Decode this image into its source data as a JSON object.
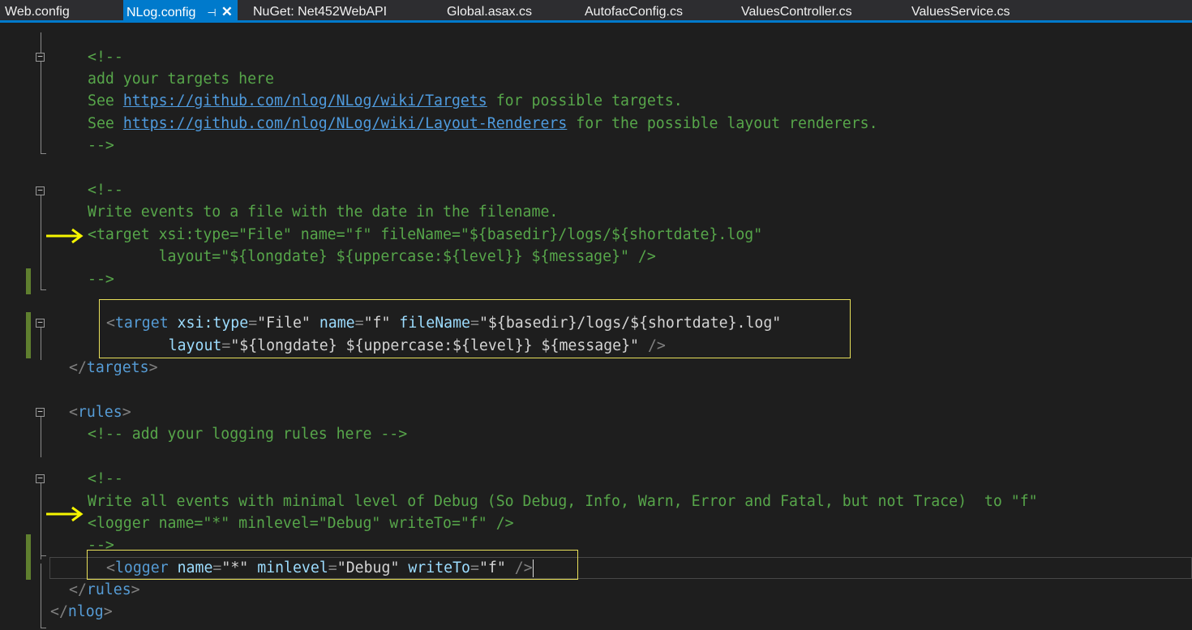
{
  "tabs": [
    {
      "label": "Web.config",
      "active": false
    },
    {
      "label": "NLog.config",
      "active": true
    },
    {
      "label": "NuGet: Net452WebAPI",
      "active": false
    },
    {
      "label": "Global.asax.cs",
      "active": false
    },
    {
      "label": "AutofacConfig.cs",
      "active": false
    },
    {
      "label": "ValuesController.cs",
      "active": false
    },
    {
      "label": "ValuesService.cs",
      "active": false
    }
  ],
  "colors": {
    "comment": "#57a64a",
    "link": "#4f9bde",
    "tag": "#569cd6",
    "attribute": "#9cdcfe",
    "string": "#d4d4d4",
    "delimiter": "#808080",
    "highlight_box": "#e8e05a",
    "arrow": "#f5f500",
    "tab_accent": "#007acc"
  },
  "icons": {
    "pin": "pin-icon",
    "close": "close-icon",
    "fold": "collapse-box-icon",
    "annotation": "arrow-right-icon"
  },
  "code": {
    "c1_open": "<!--",
    "c1_add": "add your targets here",
    "c1_see": "See ",
    "c1_link1": "https://github.com/nlog/NLog/wiki/Targets",
    "c1_for1": " for possible targets.",
    "c1_link2": "https://github.com/nlog/NLog/wiki/Layout-Renderers",
    "c1_for2": " for the possible layout renderers.",
    "c1_close": "-->",
    "c2_open": "<!--",
    "c2_text": "Write events to a file with the date in the filename.",
    "c2_target": "<target xsi:type=\"File\" name=\"f\" fileName=\"${basedir}/logs/${shortdate}.log\"",
    "c2_layout": "        layout=\"${longdate} ${uppercase:${level}} ${message}\" />",
    "c2_close": "-->",
    "tgt_lt": "<",
    "tgt_tag": "target",
    "tgt_a1": "xsi:type",
    "tgt_v1": "\"File\"",
    "tgt_a2": "name",
    "tgt_v2": "\"f\"",
    "tgt_a3": "fileName",
    "tgt_v3": "\"${basedir}/logs/${shortdate}.log\"",
    "tgt_a4": "layout",
    "tgt_v4": "\"${longdate} ${uppercase:${level}} ${message}\"",
    "tgt_end": "/>",
    "eq": "=",
    "targets_close_lt": "</",
    "targets_tag": "targets",
    "gt": ">",
    "rules_lt": "<",
    "rules_tag": "rules",
    "rules_comment": "<!-- add your logging rules here -->",
    "c3_open": "<!--",
    "c3_text": "Write all events with minimal level of Debug (So Debug, Info, Warn, Error and Fatal, but not Trace)  to \"f\"",
    "c3_logger": "<logger name=\"*\" minlevel=\"Debug\" writeTo=\"f\" />",
    "c3_close": "-->",
    "lg_tag": "logger",
    "lg_a1": "name",
    "lg_v1": "\"*\"",
    "lg_a2": "minlevel",
    "lg_v2": "\"Debug\"",
    "lg_a3": "writeTo",
    "lg_v3": "\"f\"",
    "lg_end": "/>",
    "rules_close_tag": "rules",
    "nlog_tag": "nlog"
  }
}
